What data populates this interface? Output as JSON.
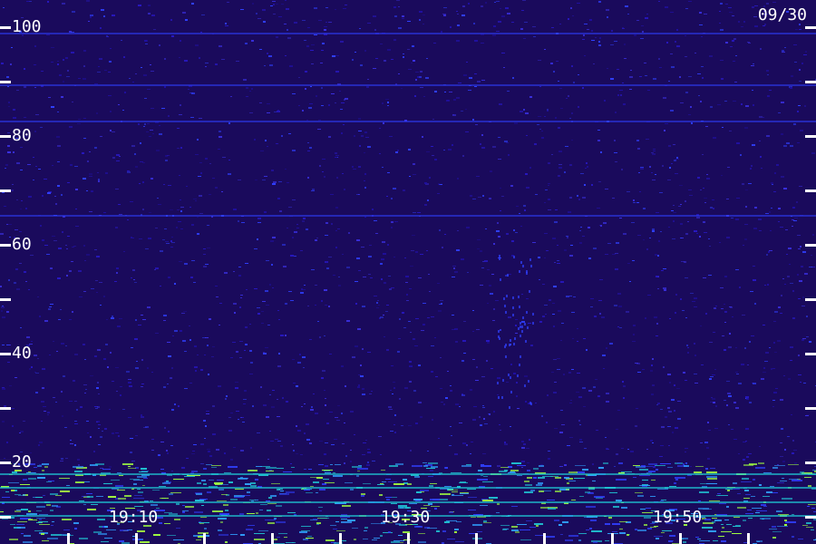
{
  "chart_data": {
    "type": "heatmap",
    "title": "",
    "date_label": "09/30",
    "y_ticks": [
      {
        "value": 100,
        "label": "100"
      },
      {
        "value": 90,
        "label": ""
      },
      {
        "value": 80,
        "label": "80"
      },
      {
        "value": 70,
        "label": ""
      },
      {
        "value": 60,
        "label": "60"
      },
      {
        "value": 50,
        "label": ""
      },
      {
        "value": 40,
        "label": "40"
      },
      {
        "value": 30,
        "label": ""
      },
      {
        "value": 20,
        "label": "20"
      },
      {
        "value": 10,
        "label": ""
      }
    ],
    "ylim": [
      5,
      105
    ],
    "x_ticks": [
      {
        "minutes": 5,
        "label": ""
      },
      {
        "minutes": 10,
        "label": "19:10"
      },
      {
        "minutes": 15,
        "label": ""
      },
      {
        "minutes": 20,
        "label": ""
      },
      {
        "minutes": 25,
        "label": ""
      },
      {
        "minutes": 30,
        "label": "19:30"
      },
      {
        "minutes": 35,
        "label": ""
      },
      {
        "minutes": 40,
        "label": ""
      },
      {
        "minutes": 45,
        "label": ""
      },
      {
        "minutes": 50,
        "label": "19:50"
      },
      {
        "minutes": 55,
        "label": ""
      }
    ],
    "xlim": [
      0,
      60
    ],
    "colors": {
      "background": "#1a0a5c",
      "low": "#2010a0",
      "mid": "#3040ff",
      "high": "#20c0d0",
      "peak": "#a0ff40",
      "tick": "#ffffff"
    }
  }
}
